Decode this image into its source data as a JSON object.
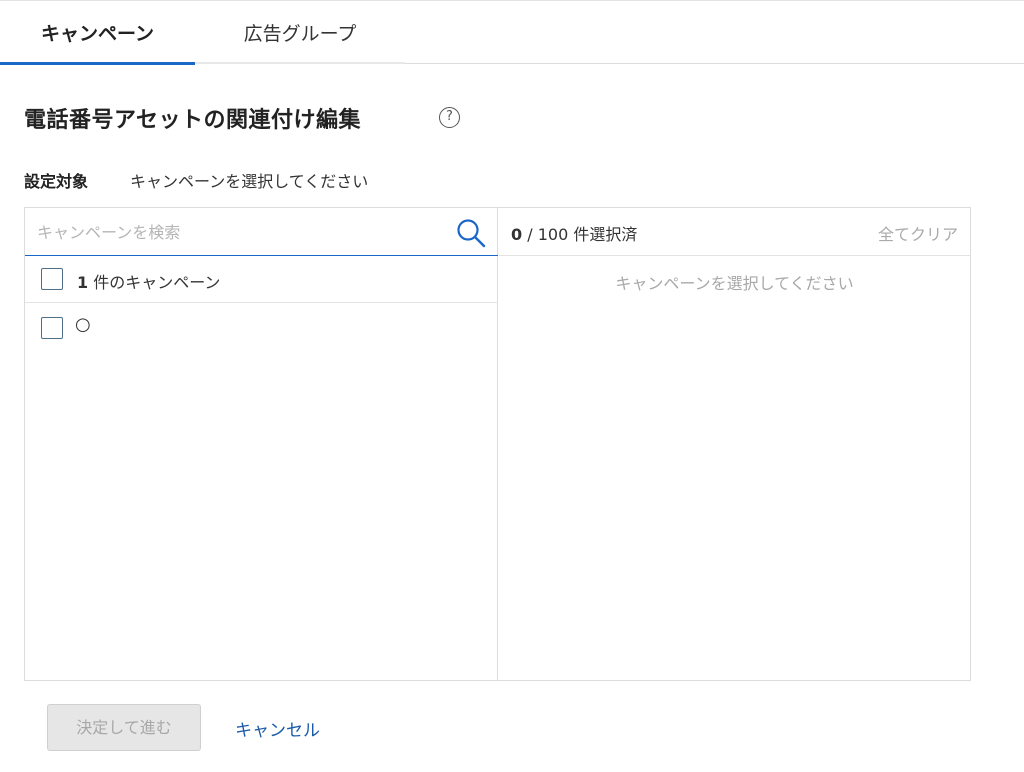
{
  "tabs": [
    {
      "label": "キャンペーン",
      "active": true
    },
    {
      "label": "広告グループ",
      "active": false
    }
  ],
  "page": {
    "title": "電話番号アセットの関連付け編集",
    "help_icon": "?"
  },
  "target": {
    "label": "設定対象",
    "text": "キャンペーンを選択してください"
  },
  "left_pane": {
    "search_placeholder": "キャンペーンを検索",
    "search_value": "",
    "header_count": "1",
    "header_suffix": " 件のキャンペーン",
    "items": [
      {
        "label": "○",
        "checked": false
      }
    ]
  },
  "right_pane": {
    "selected_count": "0",
    "selected_suffix": " / 100 件選択済",
    "clear_all": "全てクリア",
    "empty_message": "キャンペーンを選択してください"
  },
  "actions": {
    "submit_label": "決定して進む",
    "cancel_label": "キャンセル"
  },
  "colors": {
    "accent": "#1a66c9",
    "link": "#1a5aa8",
    "checkbox_border": "#4d6f88"
  }
}
